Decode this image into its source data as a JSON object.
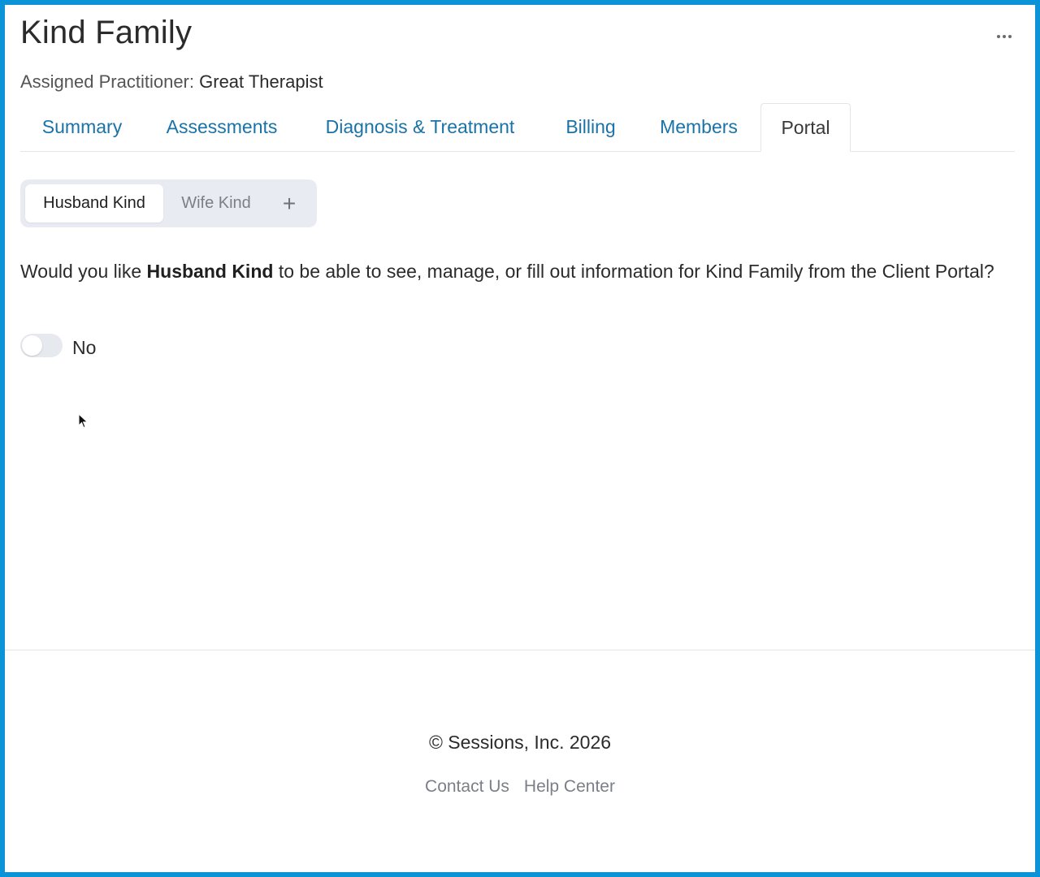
{
  "header": {
    "title": "Kind Family",
    "practitioner_label": "Assigned Practitioner:",
    "practitioner_name": "Great Therapist"
  },
  "tabs": [
    {
      "label": "Summary",
      "active": false
    },
    {
      "label": "Assessments",
      "active": false
    },
    {
      "label": "Diagnosis & Treatment",
      "active": false
    },
    {
      "label": "Billing",
      "active": false
    },
    {
      "label": "Members",
      "active": false
    },
    {
      "label": "Portal",
      "active": true
    }
  ],
  "members": {
    "selected": "Husband Kind",
    "other": "Wife Kind",
    "add_icon": "+"
  },
  "portal": {
    "question_prefix": "Would you like ",
    "question_member": "Husband Kind",
    "question_suffix": " to be able to see, manage, or fill out information for Kind Family from the Client Portal?",
    "toggle_state": false,
    "toggle_label": "No"
  },
  "footer": {
    "copyright": "© Sessions, Inc. 2026",
    "links": [
      "Contact Us",
      "Help Center"
    ]
  },
  "icons": {
    "more": "more-horizontal-icon",
    "add": "plus-icon",
    "cursor": "mouse-pointer-icon"
  },
  "colors": {
    "frame_border": "#0a93d6",
    "tab_link": "#1a73a8",
    "segment_bg": "#e8ebf2"
  }
}
